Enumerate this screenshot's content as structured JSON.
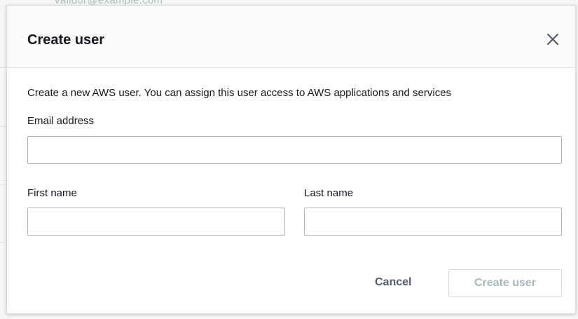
{
  "background": {
    "partial_text": "validor@example.com"
  },
  "modal": {
    "title": "Create user",
    "description": "Create a new AWS user. You can assign this user access to AWS applications and services",
    "fields": {
      "email": {
        "label": "Email address",
        "value": "",
        "placeholder": ""
      },
      "first_name": {
        "label": "First name",
        "value": "",
        "placeholder": ""
      },
      "last_name": {
        "label": "Last name",
        "value": "",
        "placeholder": ""
      }
    },
    "buttons": {
      "cancel_label": "Cancel",
      "create_label": "Create user",
      "create_disabled": true
    },
    "icons": {
      "close": "close-icon"
    },
    "colors": {
      "title_text": "#16191f",
      "input_border": "#aab7b8",
      "disabled_text": "#aab7b8",
      "cancel_text": "#545b64"
    }
  }
}
